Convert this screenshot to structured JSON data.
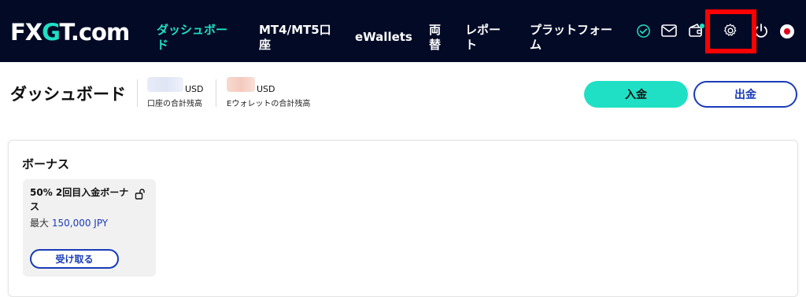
{
  "brand": {
    "logo_prefix": "FX",
    "logo_g": "G",
    "logo_suffix": "T.com",
    "accent_color": "#1fe0c4",
    "nav_bg": "#030a26",
    "link_color": "#1a3bb8"
  },
  "nav": {
    "dashboard": "ダッシュボード",
    "mt": "MT4/MT5口座",
    "ewallets": "eWallets",
    "exchange": "両替",
    "report": "レポート",
    "platform": "プラットフォーム"
  },
  "nav_icons": [
    "verified-check-icon",
    "mail-icon",
    "wallet-icon",
    "settings-gear-icon",
    "power-icon",
    "language-flag-icon"
  ],
  "header": {
    "title": "ダッシュボード",
    "account_balance": {
      "currency": "USD",
      "label": "口座の合計残高"
    },
    "ewallet_balance": {
      "currency": "USD",
      "label": "Eウォレットの合計残高"
    },
    "deposit_label": "入金",
    "withdraw_label": "出金"
  },
  "bonus": {
    "heading": "ボーナス",
    "card": {
      "title": "50% 2回目入金ボーナス",
      "max_prefix": "最大",
      "max_amount": "150,000 JPY",
      "claim_label": "受け取る"
    }
  }
}
